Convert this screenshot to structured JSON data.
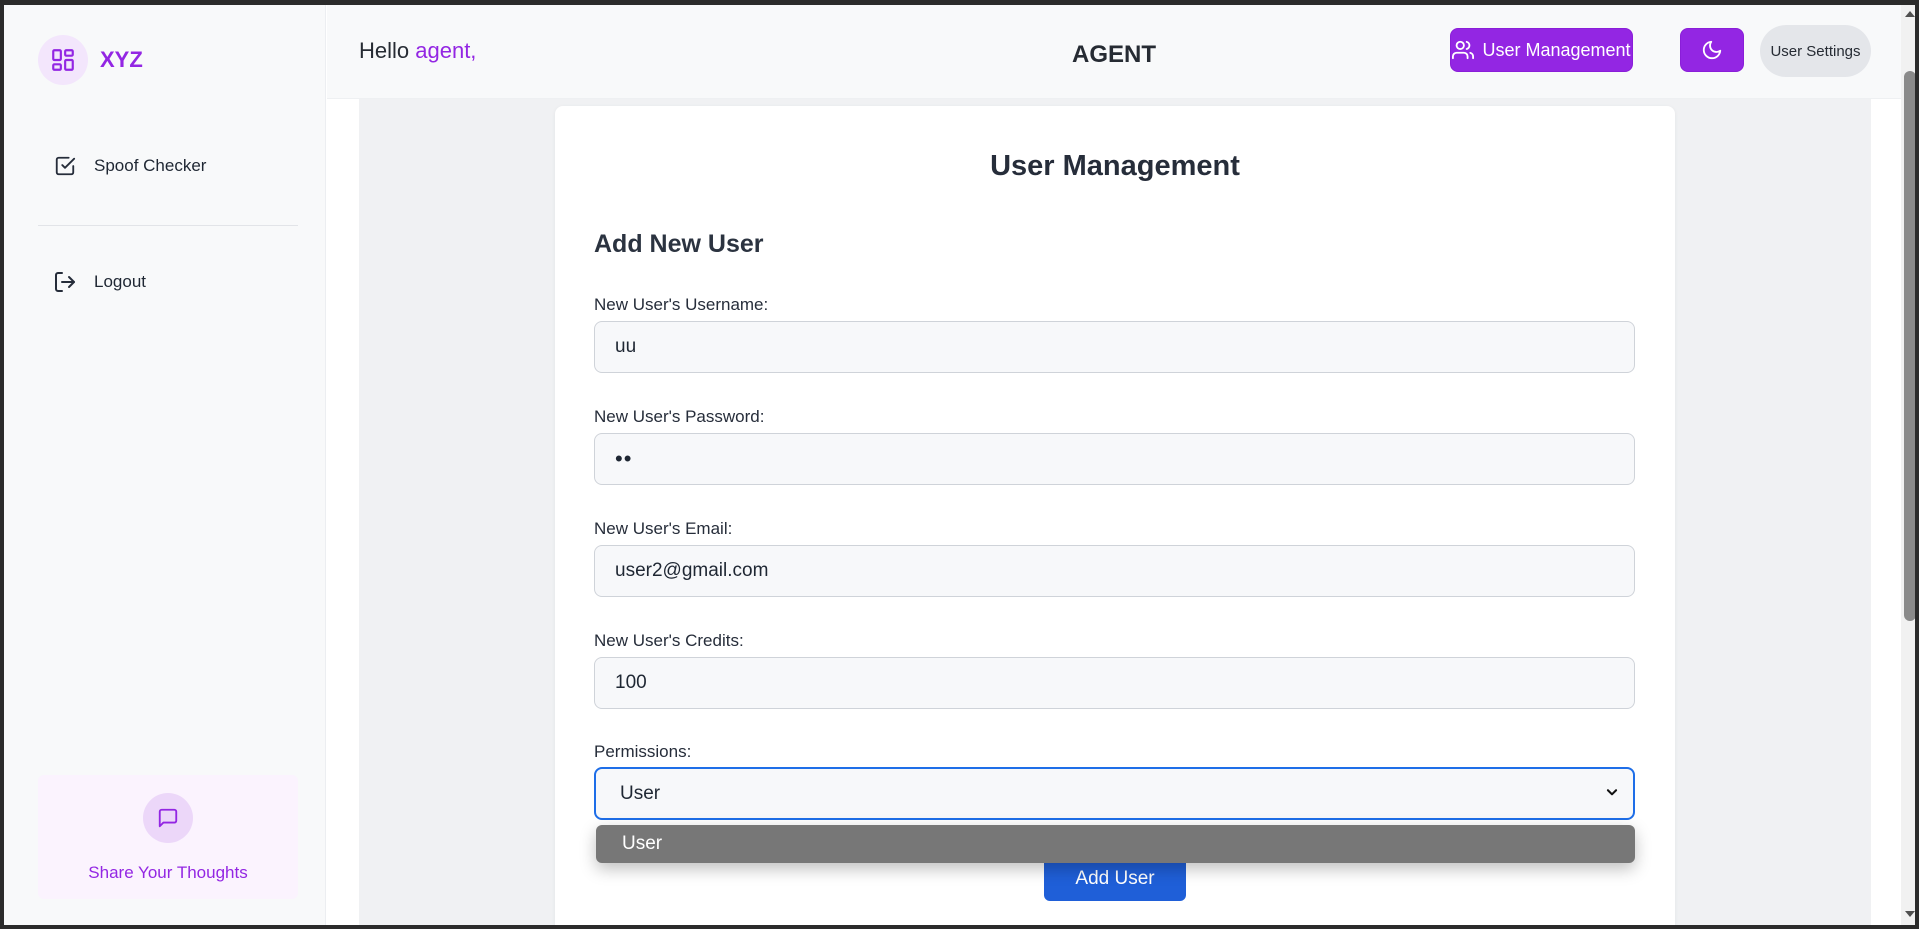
{
  "sidebar": {
    "brand": "XYZ",
    "items": [
      {
        "label": "Spoof Checker",
        "icon": "checkbox-icon"
      },
      {
        "label": "Logout",
        "icon": "logout-icon"
      }
    ],
    "feedback_label": "Share Your Thoughts"
  },
  "header": {
    "greeting_prefix": "Hello ",
    "username": "agent,",
    "title": "AGENT",
    "user_management_label": "User Management",
    "theme_icon": "moon-icon",
    "settings_label": "User Settings"
  },
  "form": {
    "title": "User Management",
    "section_title": "Add New User",
    "username_label": "New User's Username:",
    "username_value": "uu",
    "password_label": "New User's Password:",
    "password_value": "••",
    "email_label": "New User's Email:",
    "email_value": "user2@gmail.com",
    "credits_label": "New User's Credits:",
    "credits_value": "100",
    "permissions_label": "Permissions:",
    "permissions_value": "User",
    "permissions_options": [
      "User"
    ],
    "submit_label": "Add User"
  },
  "colors": {
    "accent": "#9326e3",
    "primary_button": "#1f5fd8",
    "focus_border": "#1e6ee8"
  }
}
